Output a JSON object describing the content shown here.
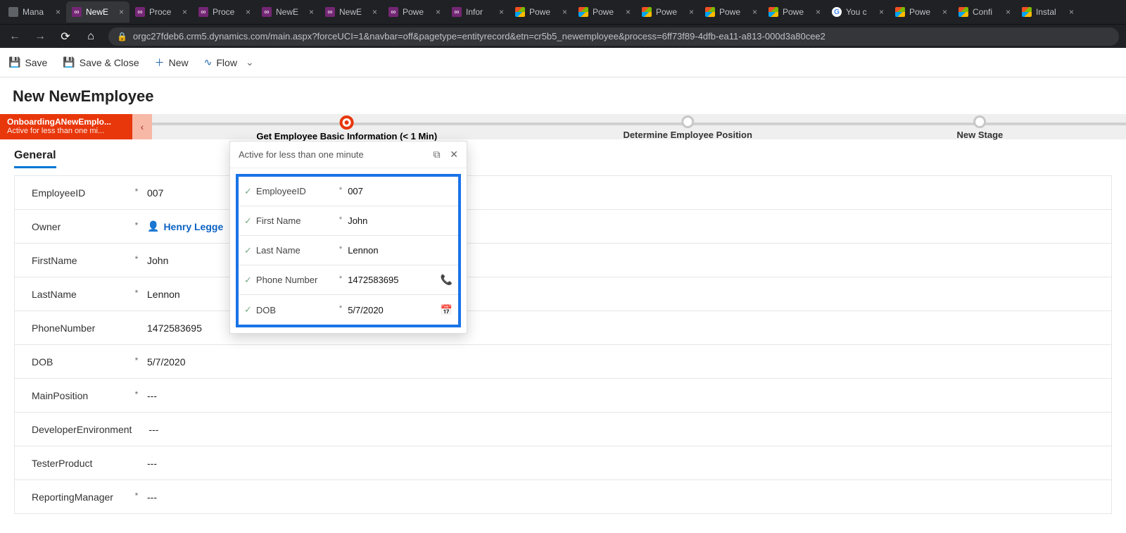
{
  "browser": {
    "url": "orgc27fdeb6.crm5.dynamics.com/main.aspx?forceUCI=1&navbar=off&pagetype=entityrecord&etn=cr5b5_newemployee&process=6ff73f89-4dfb-ea11-a813-000d3a80cee2",
    "tabs": [
      {
        "label": "Mana",
        "fav": "other"
      },
      {
        "label": "NewE",
        "fav": "dyn",
        "active": true
      },
      {
        "label": "Proce",
        "fav": "dyn"
      },
      {
        "label": "Proce",
        "fav": "dyn"
      },
      {
        "label": "NewE",
        "fav": "dyn"
      },
      {
        "label": "NewE",
        "fav": "dyn"
      },
      {
        "label": "Powe",
        "fav": "dyn"
      },
      {
        "label": "Infor",
        "fav": "dyn"
      },
      {
        "label": "Powe",
        "fav": "ms"
      },
      {
        "label": "Powe",
        "fav": "ms"
      },
      {
        "label": "Powe",
        "fav": "ms"
      },
      {
        "label": "Powe",
        "fav": "ms"
      },
      {
        "label": "Powe",
        "fav": "ms"
      },
      {
        "label": "You c",
        "fav": "gg"
      },
      {
        "label": "Powe",
        "fav": "ms"
      },
      {
        "label": "Confi",
        "fav": "ms"
      },
      {
        "label": "Instal",
        "fav": "ms"
      }
    ]
  },
  "cmdbar": {
    "save": "Save",
    "saveclose": "Save & Close",
    "new": "New",
    "flow": "Flow"
  },
  "page": {
    "title": "New NewEmployee"
  },
  "bpf": {
    "name": "OnboardingANewEmplo...",
    "sub": "Active for less than one mi...",
    "stages": [
      {
        "label": "Get Employee Basic Information  (< 1 Min)",
        "pos": 20,
        "active": true
      },
      {
        "label": "Determine Employee Position",
        "pos": 55
      },
      {
        "label": "New Stage",
        "pos": 85
      }
    ]
  },
  "flyout": {
    "status": "Active for less than one minute",
    "rows": [
      {
        "label": "EmployeeID",
        "value": "007"
      },
      {
        "label": "First Name",
        "value": "John"
      },
      {
        "label": "Last Name",
        "value": "Lennon"
      },
      {
        "label": "Phone Number",
        "value": "1472583695",
        "icon": "phone"
      },
      {
        "label": "DOB",
        "value": "5/7/2020",
        "icon": "calendar"
      }
    ]
  },
  "formTabs": {
    "general": "General"
  },
  "form": {
    "rows": [
      {
        "label": "EmployeeID",
        "req": true,
        "value": "007"
      },
      {
        "label": "Owner",
        "req": true,
        "value": "Henry Legge",
        "owner": true
      },
      {
        "label": "FirstName",
        "req": true,
        "value": "John"
      },
      {
        "label": "LastName",
        "req": true,
        "value": "Lennon"
      },
      {
        "label": "PhoneNumber",
        "req": false,
        "value": "1472583695"
      },
      {
        "label": "DOB",
        "req": true,
        "value": "5/7/2020"
      },
      {
        "label": "MainPosition",
        "req": true,
        "value": "---"
      },
      {
        "label": "DeveloperEnvironment",
        "req": false,
        "value": "---"
      },
      {
        "label": "TesterProduct",
        "req": false,
        "value": "---"
      },
      {
        "label": "ReportingManager",
        "req": true,
        "value": "---"
      }
    ]
  }
}
